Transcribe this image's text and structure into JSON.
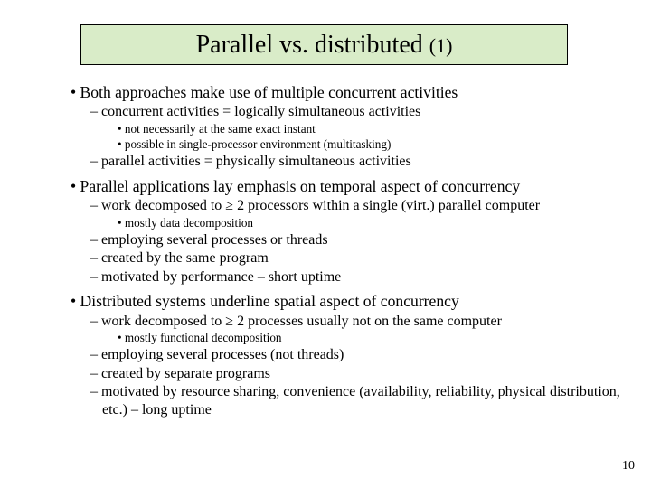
{
  "title": {
    "main": "Parallel vs. distributed ",
    "sub": "(1)"
  },
  "body": {
    "l1": "• Both approaches make use of multiple concurrent activities",
    "l2": "– concurrent activities = logically simultaneous activities",
    "l3": "• not necessarily at the same exact instant",
    "l4": "• possible in single-processor environment (multitasking)",
    "l5": "– parallel activities = physically simultaneous activities",
    "l6": "• Parallel applications lay emphasis on temporal aspect of concurrency",
    "l7": "– work decomposed to ≥ 2 processors within a single (virt.) parallel computer",
    "l8": "• mostly data decomposition",
    "l9": "– employing several processes or threads",
    "l10": "– created by the same program",
    "l11": "– motivated by performance – short uptime",
    "l12": "• Distributed systems underline spatial aspect of concurrency",
    "l13": "– work decomposed to ≥ 2 processes usually not on the same computer",
    "l14": "• mostly functional decomposition",
    "l15": "– employing several processes (not threads)",
    "l16": "– created by separate programs",
    "l17": "– motivated by resource sharing, convenience (availability, reliability, physical distribution, etc.) – long uptime"
  },
  "pagenum": "10"
}
